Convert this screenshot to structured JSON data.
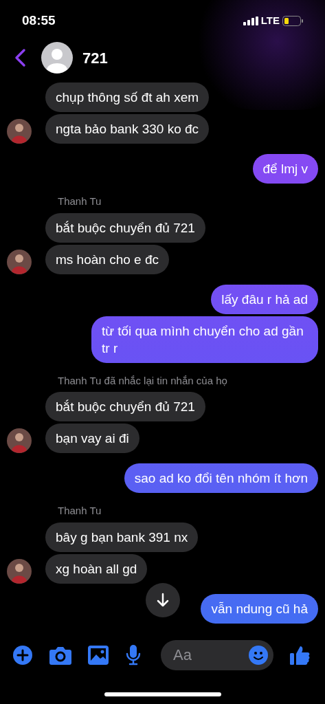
{
  "status_bar": {
    "time": "08:55",
    "network": "LTE"
  },
  "header": {
    "title": "721"
  },
  "groups": [
    {
      "kind": "incoming",
      "messages": [
        "chụp thông số đt ah xem",
        "ngta bảo bank 330 ko đc"
      ]
    },
    {
      "kind": "outgoing",
      "messages": [
        "để lmj v"
      ]
    },
    {
      "kind": "incoming",
      "label": "Thanh Tu",
      "messages": [
        "bắt buộc chuyển đủ 721",
        "ms hoàn cho e đc"
      ]
    },
    {
      "kind": "outgoing",
      "messages": [
        "lấy đâu r hả ad",
        "từ tối qua mình chuyển cho ad gần tr r"
      ]
    },
    {
      "kind": "incoming",
      "label": "Thanh Tu đã nhắc lại tin nhắn của họ",
      "messages": [
        "bắt buộc chuyển đủ 721",
        "bạn vay ai đi"
      ]
    },
    {
      "kind": "outgoing",
      "messages": [
        "sao ad ko đổi tên nhóm ít hơn"
      ]
    },
    {
      "kind": "incoming",
      "label": "Thanh Tu",
      "messages": [
        "bây g bạn bank 391 nx",
        "xg hoàn all gd"
      ]
    },
    {
      "kind": "outgoing",
      "messages": [
        "vẫn ndung cũ hả"
      ]
    }
  ],
  "composer": {
    "placeholder": "Aa"
  }
}
